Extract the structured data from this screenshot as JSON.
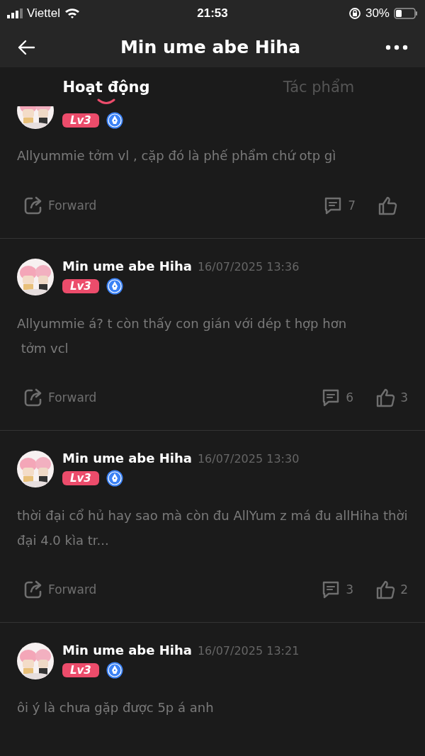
{
  "status_bar": {
    "carrier": "Viettel",
    "time": "21:53",
    "battery": "30%"
  },
  "header": {
    "title": "Min ume abe Hiha"
  },
  "tabs": [
    {
      "label": "Hoạt động",
      "selected": true
    },
    {
      "label": "Tác phẩm",
      "selected": false
    }
  ],
  "posts": [
    {
      "cut_top": true,
      "level_badge": "Lv3",
      "text": "Allyummie tởm vl , cặp đó là phế phẩm chứ otp gì",
      "actions": {
        "forward": "Forward",
        "comments": "7"
      }
    },
    {
      "cut_top": false,
      "author": "Min ume abe Hiha",
      "date": "16/07/2025 13:36",
      "level_badge": "Lv3",
      "text": "Allyummie á? t còn thấy con gián với dép t hợp hơn\n tởm vcl",
      "actions": {
        "forward": "Forward",
        "comments": "6",
        "likes": "3"
      }
    },
    {
      "cut_top": false,
      "author": "Min ume abe Hiha",
      "date": "16/07/2025 13:30",
      "level_badge": "Lv3",
      "text": "thời đại cổ hủ hay sao mà còn đu AllYum z má đu allHiha thời đại 4.0 kìa tr...",
      "actions": {
        "forward": "Forward",
        "comments": "3",
        "likes": "2"
      }
    },
    {
      "cut_top": false,
      "author": "Min ume abe Hiha",
      "date": "16/07/2025 13:21",
      "level_badge": "Lv3",
      "text": "ôi ý là chưa gặp được 5p á anh"
    }
  ]
}
